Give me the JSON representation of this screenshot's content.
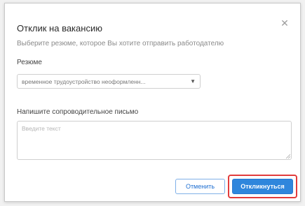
{
  "dialog": {
    "title": "Отклик на вакансию",
    "subtitle": "Выберите резюме, которое Вы хотите отправить работодателю",
    "close_icon": "close-icon",
    "resume": {
      "label": "Резюме",
      "selected": "временное трудоустройство неоформленн..."
    },
    "letter": {
      "label": "Напишите сопроводительное письмо",
      "placeholder": "Введите текст",
      "value": ""
    },
    "buttons": {
      "cancel": "Отменить",
      "submit": "Откликнуться"
    }
  },
  "colors": {
    "accent": "#2f86dc",
    "highlight": "#e23b3b"
  }
}
